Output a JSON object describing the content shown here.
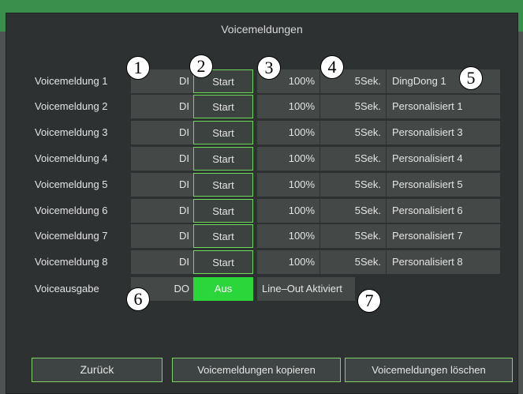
{
  "dialog": {
    "title": "Voicemeldungen"
  },
  "rows": [
    {
      "label": "Voicemeldung 1",
      "di": "DI",
      "start": "Start",
      "volume": "100%",
      "duration": "5Sek.",
      "sound": "DingDong 1"
    },
    {
      "label": "Voicemeldung 2",
      "di": "DI",
      "start": "Start",
      "volume": "100%",
      "duration": "5Sek.",
      "sound": "Personalisiert 1"
    },
    {
      "label": "Voicemeldung 3",
      "di": "DI",
      "start": "Start",
      "volume": "100%",
      "duration": "5Sek.",
      "sound": "Personalisiert 3"
    },
    {
      "label": "Voicemeldung 4",
      "di": "DI",
      "start": "Start",
      "volume": "100%",
      "duration": "5Sek.",
      "sound": "Personalisiert 4"
    },
    {
      "label": "Voicemeldung 5",
      "di": "DI",
      "start": "Start",
      "volume": "100%",
      "duration": "5Sek.",
      "sound": "Personalisiert 5"
    },
    {
      "label": "Voicemeldung 6",
      "di": "DI",
      "start": "Start",
      "volume": "100%",
      "duration": "5Sek.",
      "sound": "Personalisiert 6"
    },
    {
      "label": "Voicemeldung 7",
      "di": "DI",
      "start": "Start",
      "volume": "100%",
      "duration": "5Sek.",
      "sound": "Personalisiert 7"
    },
    {
      "label": "Voicemeldung 8",
      "di": "DI",
      "start": "Start",
      "volume": "100%",
      "duration": "5Sek.",
      "sound": "Personalisiert 8"
    }
  ],
  "output": {
    "label": "Voiceausgabe",
    "do": "DO",
    "state": "Aus",
    "line_out": "Line–Out Aktiviert"
  },
  "markers": [
    "1",
    "2",
    "3",
    "4",
    "5",
    "6",
    "7"
  ],
  "buttons": {
    "back": "Zurück",
    "copy": "Voicemeldungen kopieren",
    "delete": "Voicemeldungen löschen"
  },
  "colors": {
    "accent": "#2bd63a",
    "border_accent": "#6fd95a",
    "dialog_bg": "#2d3131",
    "cell_bg": "#444948"
  }
}
